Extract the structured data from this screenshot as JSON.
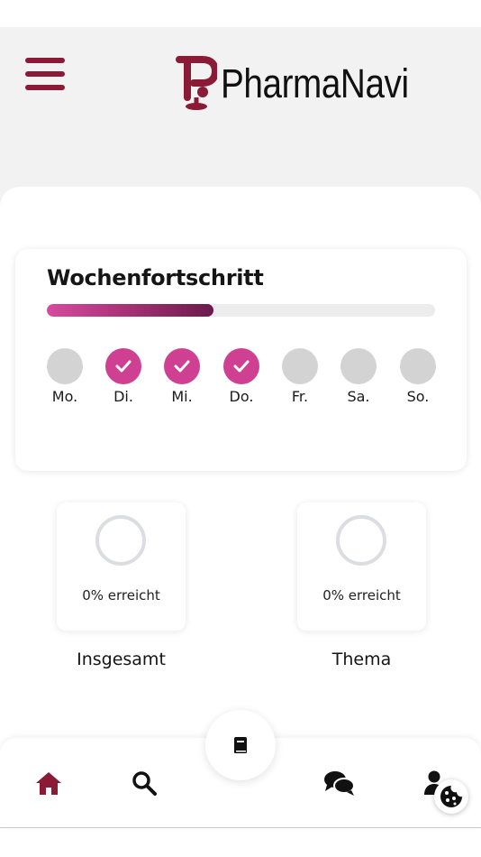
{
  "app": {
    "brand_name": "PharmaNavi",
    "brand_color": "#8b1a36"
  },
  "header": {
    "menu_icon": "hamburger-menu-icon",
    "logo_icon": "pharmanavi-logo-icon"
  },
  "weekly_progress": {
    "title": "Wochenfortschritt",
    "progress_fraction": 0.43,
    "accent_color": "#cf3f92",
    "days": [
      {
        "label": "Mo.",
        "done": false
      },
      {
        "label": "Di.",
        "done": true
      },
      {
        "label": "Mi.",
        "done": true
      },
      {
        "label": "Do.",
        "done": true
      },
      {
        "label": "Fr.",
        "done": false
      },
      {
        "label": "Sa.",
        "done": false
      },
      {
        "label": "So.",
        "done": false
      }
    ]
  },
  "stats": [
    {
      "value_text": "0% erreicht",
      "label": "Insgesamt",
      "value": 0
    },
    {
      "value_text": "0% erreicht",
      "label": "Thema",
      "value": 0
    }
  ],
  "bottom_nav": {
    "items": [
      {
        "name": "home",
        "icon": "home-icon",
        "active": true
      },
      {
        "name": "search",
        "icon": "search-icon",
        "active": false
      },
      {
        "name": "learn",
        "icon": "book-icon",
        "active": false
      },
      {
        "name": "chat",
        "icon": "chat-icon",
        "active": false
      },
      {
        "name": "profile",
        "icon": "user-icon",
        "active": false
      }
    ],
    "cookie_icon": "cookie-icon"
  }
}
